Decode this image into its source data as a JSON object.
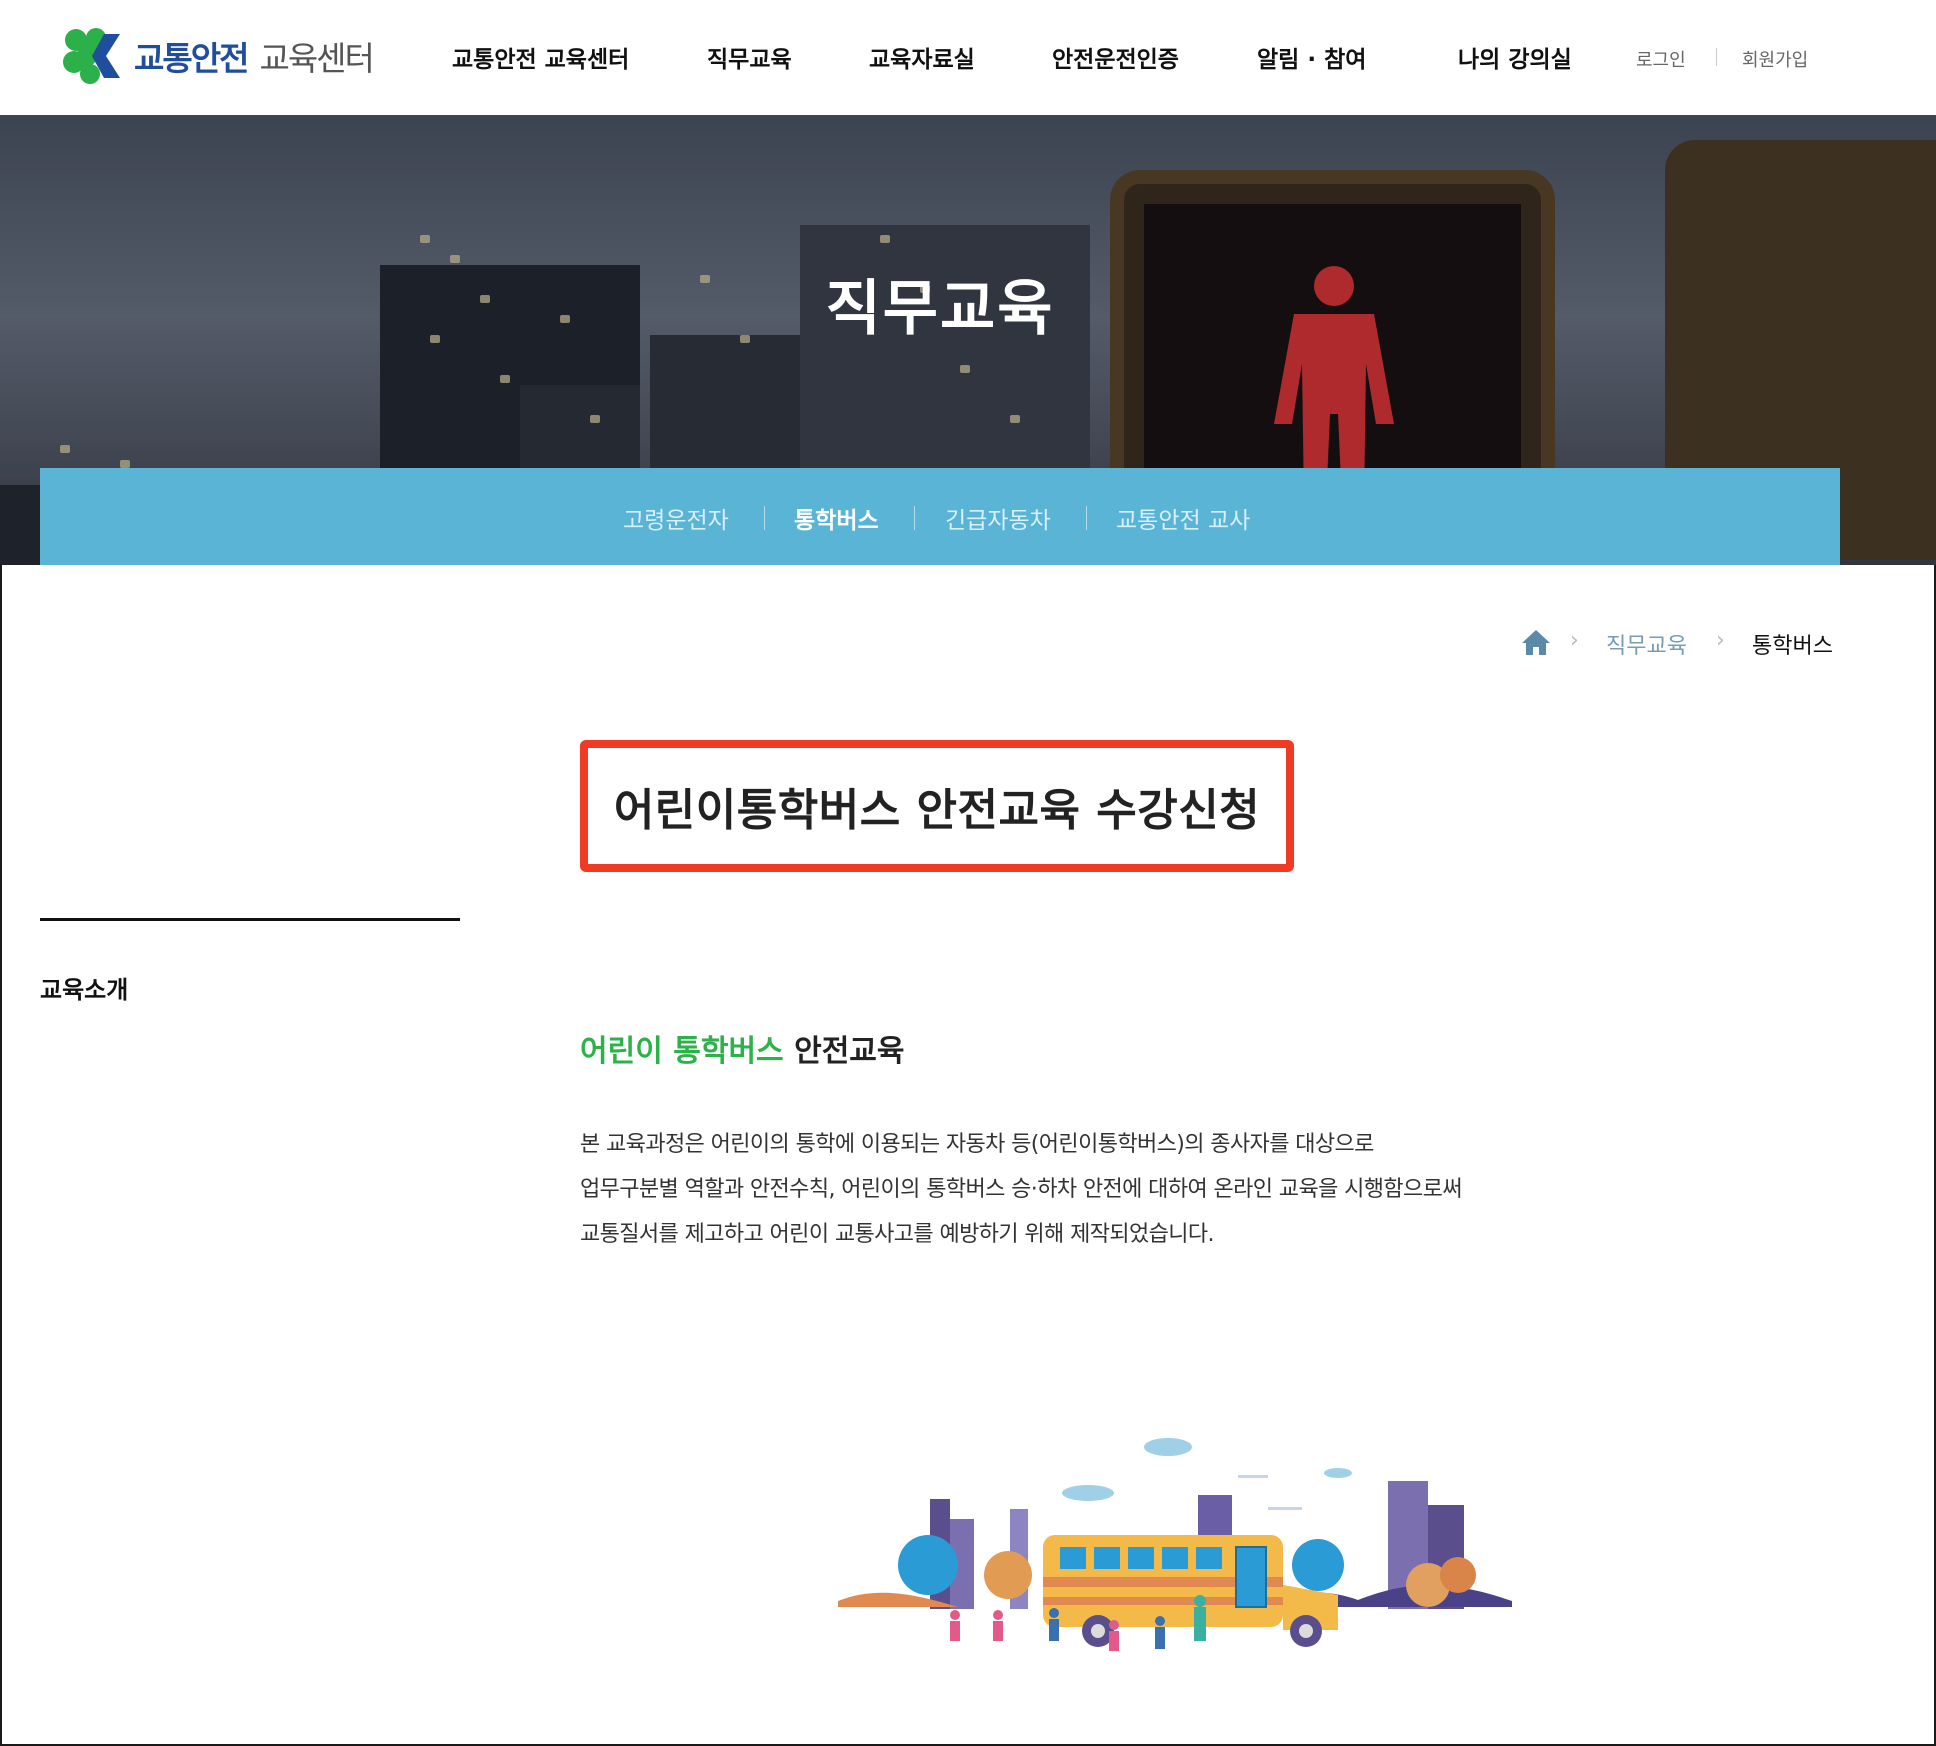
{
  "header": {
    "logo": {
      "main": "교통안전",
      "sub": "교육센터"
    },
    "nav": [
      "교통안전 교육센터",
      "직무교육",
      "교육자료실",
      "안전운전인증",
      "알림 · 참여",
      "나의 강의실"
    ],
    "util": {
      "login": "로그인",
      "signup": "회원가입"
    }
  },
  "hero": {
    "title": "직무교육",
    "tabs": [
      "고령운전자",
      "통학버스",
      "긴급자동차",
      "교통안전 교사"
    ],
    "active_tab": "통학버스"
  },
  "breadcrumb": {
    "home_icon": "home-icon",
    "items": [
      "직무교육",
      "통학버스"
    ]
  },
  "page": {
    "title": "어린이통학버스 안전교육 수강신청"
  },
  "sidebar": {
    "items": [
      "교육소개"
    ]
  },
  "content": {
    "section_title_highlight": "어린이 통학버스",
    "section_title_rest": "안전교육",
    "lines": [
      "본 교육과정은 어린이의 통학에 이용되는 자동차 등(어린이통학버스)의 종사자를 대상으로",
      "업무구분별 역할과 안전수칙, 어린이의 통학버스 승·하차 안전에 대하여 온라인 교육을 시행함으로써",
      "교통질서를 제고하고 어린이 교통사고를 예방하기 위해 제작되었습니다."
    ]
  },
  "colors": {
    "brand_blue": "#1f4e9c",
    "subnav_bg": "#5ab4d6",
    "highlight_green": "#2db24a",
    "title_box_border": "#f03a23"
  }
}
